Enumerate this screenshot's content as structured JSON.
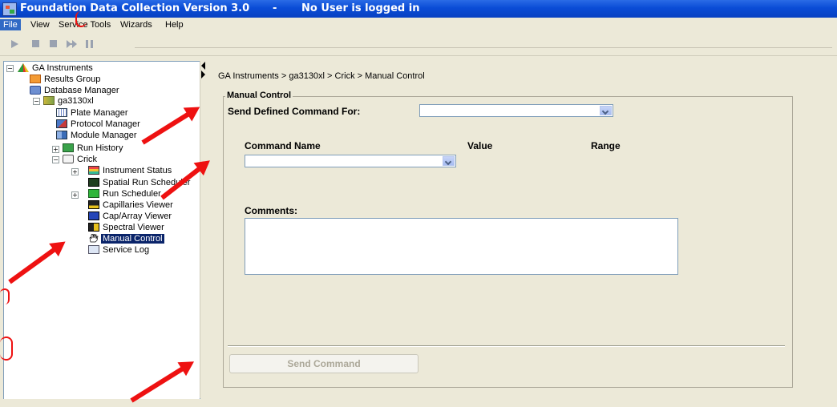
{
  "window": {
    "title": "Foundation Data Collection Version 3.0",
    "separator": "-",
    "user_status": "No User is logged in"
  },
  "menu": [
    "File",
    "View",
    "Service Tools",
    "Wizards",
    "Help"
  ],
  "toolbar": {
    "icons": [
      "play-icon",
      "stop-icon",
      "stop-icon",
      "skip-icon",
      "pause-icon"
    ]
  },
  "tree": {
    "root": "GA Instruments",
    "results_group": "Results Group",
    "database_manager": "Database Manager",
    "instrument": "ga3130xl",
    "plate_manager": "Plate Manager",
    "protocol_manager": "Protocol Manager",
    "module_manager": "Module Manager",
    "run_history": "Run History",
    "crick": "Crick",
    "instrument_status": "Instrument Status",
    "spatial_run_scheduler": "Spatial Run Scheduler",
    "run_scheduler": "Run Scheduler",
    "capillaries_viewer": "Capillaries Viewer",
    "cap_array_viewer": "Cap/Array Viewer",
    "spectral_viewer": "Spectral Viewer",
    "manual_control": "Manual Control",
    "service_log": "Service Log",
    "selected": "Manual Control"
  },
  "main": {
    "breadcrumb": "GA Instruments > ga3130xl > Crick > Manual Control",
    "group_title": "Manual Control",
    "send_defined_for_label": "Send Defined Command For:",
    "send_defined_for_value": "",
    "columns": {
      "command_name": "Command Name",
      "value": "Value",
      "range": "Range"
    },
    "command_name_value": "",
    "comments_label": "Comments:",
    "comments_value": "",
    "send_button": "Send Command"
  },
  "colors": {
    "title_bar": "#0a4cd6",
    "selection": "#0a246a",
    "annotation_arrows": "#ee1111"
  }
}
